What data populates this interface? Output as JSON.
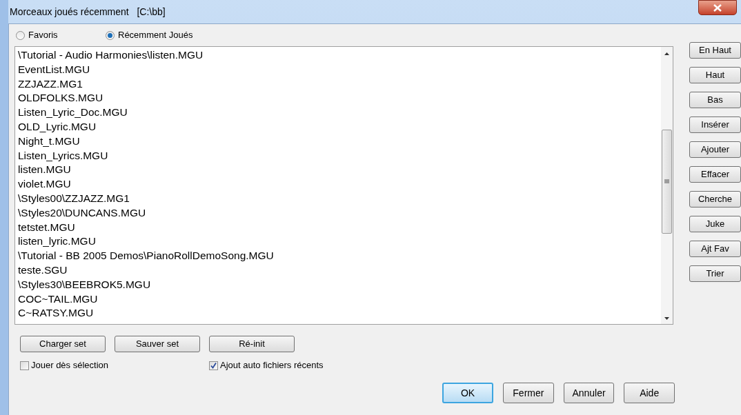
{
  "window": {
    "title": "Morceaux joués récemment   [C:\\bb]"
  },
  "radios": [
    {
      "label": "Favoris",
      "selected": false
    },
    {
      "label": "Récemment Joués",
      "selected": true
    }
  ],
  "files": [
    "\\Tutorial - Audio Harmonies\\listen.MGU",
    "EventList.MGU",
    "ZZJAZZ.MG1",
    "OLDFOLKS.MGU",
    "Listen_Lyric_Doc.MGU",
    "OLD_Lyric.MGU",
    "Night_t.MGU",
    "Listen_Lyrics.MGU",
    "listen.MGU",
    "violet.MGU",
    "\\Styles00\\ZZJAZZ.MG1",
    "\\Styles20\\DUNCANS.MGU",
    "tetstet.MGU",
    "listen_lyric.MGU",
    "\\Tutorial - BB 2005 Demos\\PianoRollDemoSong.MGU",
    "teste.SGU",
    "\\Styles30\\BEEBROK5.MGU",
    "COC~TAIL.MGU",
    "C~RATSY.MGU"
  ],
  "side_buttons": [
    "En Haut",
    "Haut",
    "Bas",
    "Insérer",
    "Ajouter",
    "Effacer",
    "Cherche",
    "Juke",
    "Ajt Fav",
    "Trier"
  ],
  "set_buttons": [
    "Charger set",
    "Sauver set",
    "Ré-init"
  ],
  "checkboxes": [
    {
      "label": "Jouer dès sélection",
      "checked": false
    },
    {
      "label": "Ajout auto fichiers récents",
      "checked": true
    }
  ],
  "dialog_buttons": [
    {
      "label": "OK",
      "default": true
    },
    {
      "label": "Fermer",
      "default": false
    },
    {
      "label": "Annuler",
      "default": false
    },
    {
      "label": "Aide",
      "default": false
    }
  ]
}
